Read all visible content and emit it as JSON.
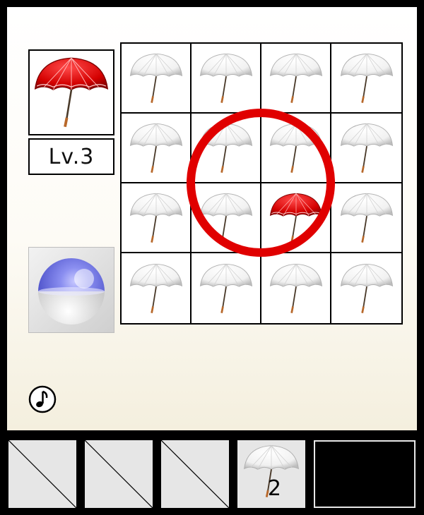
{
  "target": {
    "item": "red-umbrella",
    "level_label": "Lv.3"
  },
  "grid": {
    "cells": [
      {
        "item": "white-umbrella"
      },
      {
        "item": "white-umbrella"
      },
      {
        "item": "white-umbrella"
      },
      {
        "item": "white-umbrella"
      },
      {
        "item": "white-umbrella"
      },
      {
        "item": "white-umbrella"
      },
      {
        "item": "white-umbrella"
      },
      {
        "item": "white-umbrella"
      },
      {
        "item": "white-umbrella"
      },
      {
        "item": "white-umbrella"
      },
      {
        "item": "red-umbrella"
      },
      {
        "item": "white-umbrella"
      },
      {
        "item": "white-umbrella"
      },
      {
        "item": "white-umbrella"
      },
      {
        "item": "white-umbrella"
      },
      {
        "item": "white-umbrella"
      }
    ]
  },
  "colors": {
    "ring": "#e00000",
    "orb_top": "#6b6fe0",
    "red_canopy": "#d40000"
  },
  "inventory": {
    "slots": [
      {
        "state": "empty"
      },
      {
        "state": "empty"
      },
      {
        "state": "empty"
      },
      {
        "state": "item",
        "item": "white-umbrella",
        "count": "2"
      },
      {
        "state": "selected-black"
      }
    ]
  }
}
